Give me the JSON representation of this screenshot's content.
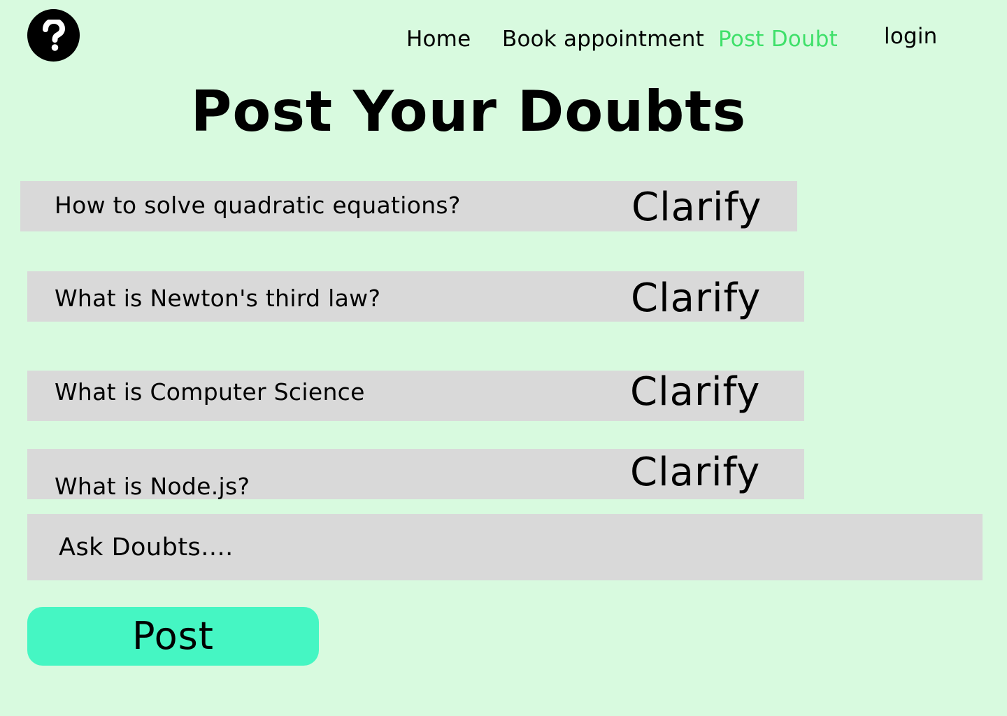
{
  "theme": {
    "background": "#d8fadf",
    "row_background": "#d9d9d9",
    "active_nav_color": "#3fe06a",
    "post_button_color": "#45f6c3",
    "logo_color": "#000000"
  },
  "header": {
    "logo_icon": "question-mark-icon",
    "nav": {
      "home": "Home",
      "book": "Book appointment",
      "post": "Post Doubt",
      "login": "login"
    },
    "active_nav": "post"
  },
  "main": {
    "title": "Post Your Doubts",
    "doubts": [
      {
        "question": "How to solve quadratic equations?",
        "action": "Clarify"
      },
      {
        "question": "What is Newton's third law?",
        "action": "Clarify"
      },
      {
        "question": "What is Computer Science",
        "action": "Clarify"
      },
      {
        "question": "What is Node.js?",
        "action": "Clarify"
      }
    ],
    "ask": {
      "placeholder": "Ask Doubts....",
      "value": ""
    },
    "post_label": "Post"
  }
}
